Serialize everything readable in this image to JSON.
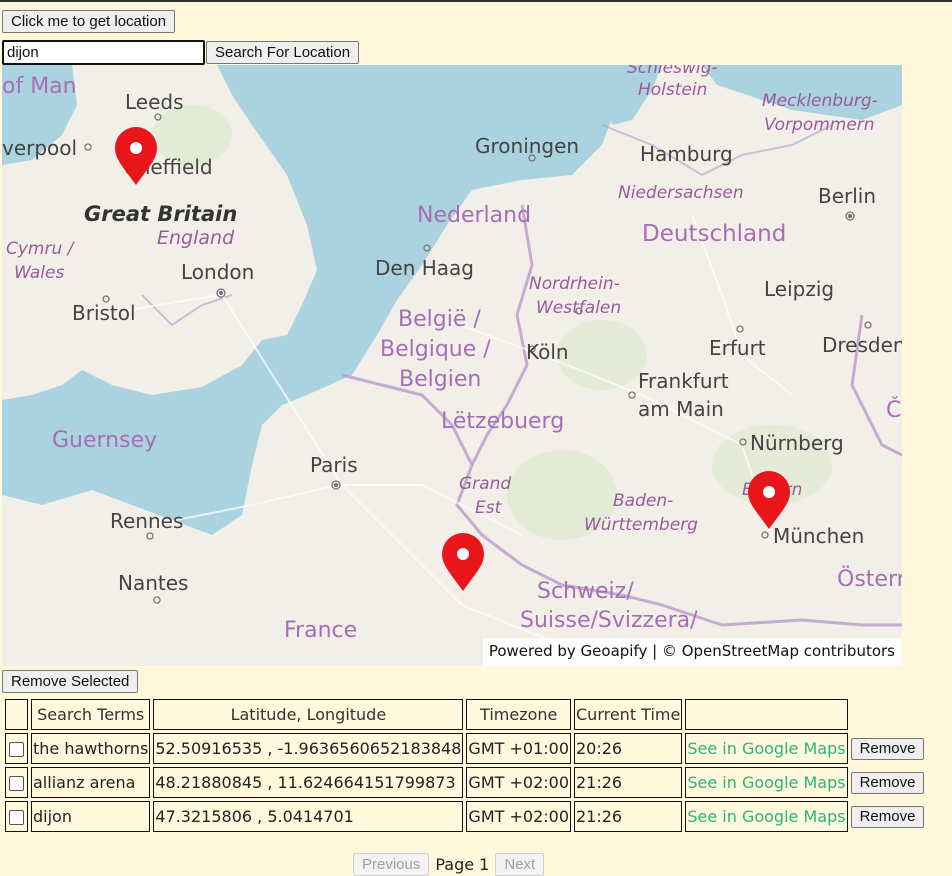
{
  "controls": {
    "locate_label": "Click me to get location",
    "search_value": "dijon",
    "search_label": "Search For Location",
    "remove_selected_label": "Remove Selected"
  },
  "map": {
    "attribution_powered": "Powered by Geoapify",
    "attribution_sep": " | © ",
    "attribution_osm": "OpenStreetMap",
    "attribution_contrib": " contributors",
    "labels": {
      "isle_of_man": "of Man",
      "leeds": "Leeds",
      "liverpool": "verpool",
      "sheffield": "Sheffield",
      "great_britain": "Great Britain",
      "england": "England",
      "cymru": "Cymru /",
      "wales": "Wales",
      "london": "London",
      "bristol": "Bristol",
      "groningen": "Groningen",
      "hamburg": "Hamburg",
      "schleswig": "Schleswig-",
      "holstein": "Holstein",
      "mecklenburg": "Mecklenburg-",
      "vorpommern": "Vorpommern",
      "niedersachsen": "Niedersachsen",
      "berlin": "Berlin",
      "nederland": "Nederland",
      "deutschland": "Deutschland",
      "den_haag": "Den Haag",
      "nordrhein": "Nordrhein-",
      "westfalen": "Westfalen",
      "leipzig": "Leipzig",
      "belgie1": "België /",
      "belgie2": "Belgique /",
      "belgie3": "Belgien",
      "koln": "Köln",
      "erfurt": "Erfurt",
      "dresden": "Dresden",
      "frankfurt1": "Frankfurt",
      "frankfurt2": "am Main",
      "letzebuerg": "Lëtzebuerg",
      "guernsey": "Guernsey",
      "nurnberg": "Nürnberg",
      "paris": "Paris",
      "grand": "Grand",
      "est": "Est",
      "baden": "Baden-",
      "wurttemberg": "Württemberg",
      "bayern": "Bayern",
      "rennes": "Rennes",
      "munchen": "München",
      "nantes": "Nantes",
      "schweiz1": "Schweiz/",
      "schweiz2": "Suisse/Svizzera/",
      "france": "France",
      "osterreich": "Österreich",
      "cz": "Č"
    },
    "markers": [
      {
        "name": "the hawthorns",
        "lat": 52.50916535,
        "lon": -1.9636560652183848
      },
      {
        "name": "allianz arena",
        "lat": 48.21880845,
        "lon": 11.624664151799873
      },
      {
        "name": "dijon",
        "lat": 47.3215806,
        "lon": 5.0414701
      }
    ]
  },
  "table": {
    "headers": [
      "",
      "Search Terms",
      "Latitude, Longitude",
      "Timezone",
      "Current Time",
      ""
    ],
    "rows": [
      {
        "term": "the hawthorns",
        "coords": "52.50916535 , -1.9636560652183848",
        "tz": "GMT +01:00",
        "time": "20:26",
        "link": "See in Google Maps",
        "remove": "Remove"
      },
      {
        "term": "allianz arena",
        "coords": "48.21880845 , 11.624664151799873",
        "tz": "GMT +02:00",
        "time": "21:26",
        "link": "See in Google Maps",
        "remove": "Remove"
      },
      {
        "term": "dijon",
        "coords": "47.3215806 , 5.0414701",
        "tz": "GMT +02:00",
        "time": "21:26",
        "link": "See in Google Maps",
        "remove": "Remove"
      }
    ]
  },
  "pager": {
    "previous": "Previous",
    "page": "Page 1",
    "next": "Next"
  },
  "colors": {
    "background": "#fff8dc",
    "sea": "#aad3df",
    "land": "#f2efe9",
    "marker": "#e8161a",
    "link": "#2db37a",
    "region_label": "#9b5b9b"
  }
}
